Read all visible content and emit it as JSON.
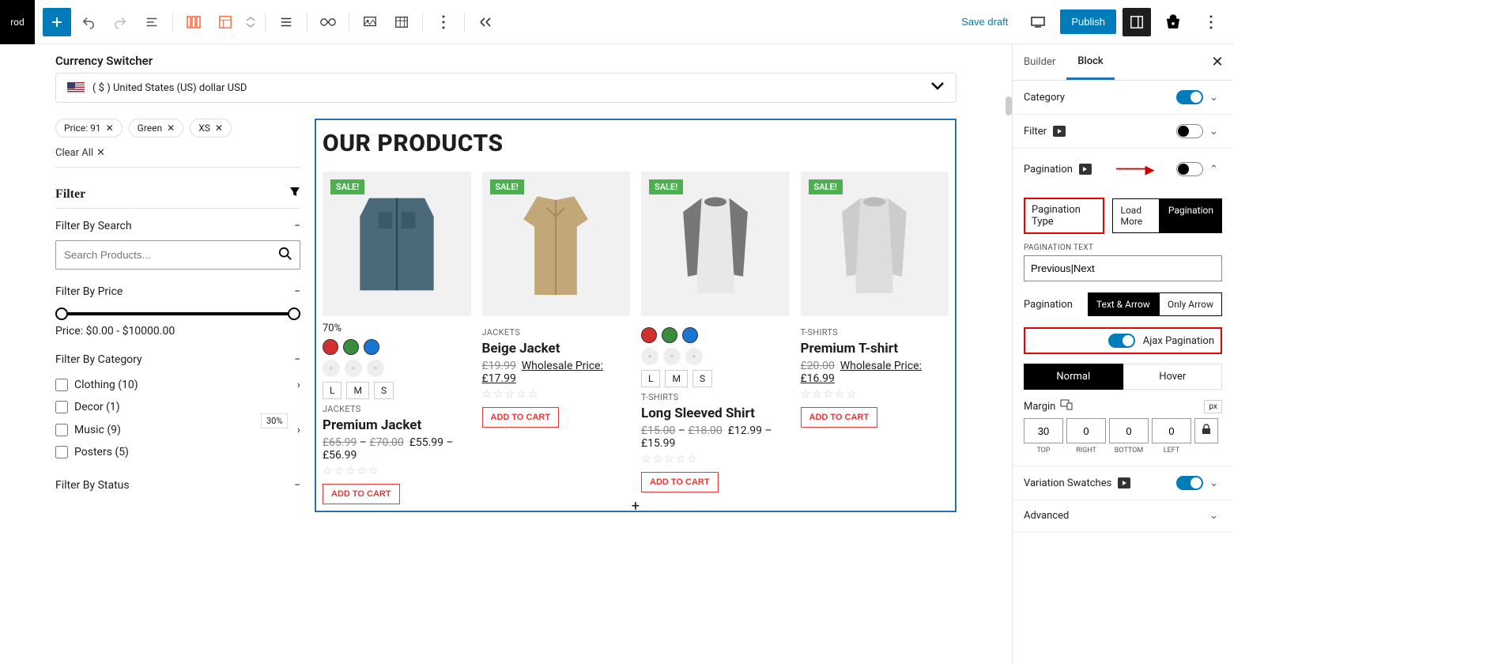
{
  "topbar": {
    "brand": "rod",
    "save_draft": "Save draft",
    "publish": "Publish"
  },
  "currency": {
    "title": "Currency Switcher",
    "value": "( $ ) United States (US) dollar USD"
  },
  "filters": {
    "chips": [
      {
        "label": "Price: 91"
      },
      {
        "label": "Green"
      },
      {
        "label": "XS"
      }
    ],
    "clear_all": "Clear All",
    "filter_head": "Filter",
    "search_head": "Filter By Search",
    "search_placeholder": "Search Products...",
    "price_head": "Filter By Price",
    "price_label": "Price: $0.00 - $10000.00",
    "category_head": "Filter By Category",
    "categories": [
      {
        "label": "Clothing (10)",
        "hasChildren": true
      },
      {
        "label": "Decor (1)",
        "hasChildren": false
      },
      {
        "label": "Music (9)",
        "hasChildren": true
      },
      {
        "label": "Posters (5)",
        "hasChildren": false
      }
    ],
    "discount_badge": "30%",
    "status_head": "Filter By Status"
  },
  "products": {
    "heading": "OUR PRODUCTS",
    "sale_label": "SALE!",
    "add_to_cart": "ADD TO CART",
    "items": [
      {
        "stock_pct": "70%",
        "category": "JACKETS",
        "title": "Premium Jacket",
        "price_html": "£65.99 – £70.00  £55.99 – £56.99",
        "old1": "£65.99",
        "old2": "£70.00",
        "new1": "£55.99",
        "new2": "£56.99",
        "img_kind": "denim"
      },
      {
        "category": "JACKETS",
        "title": "Beige Jacket",
        "old": "£19.99",
        "wholesale": "Wholesale Price:£17.99",
        "img_kind": "beige"
      },
      {
        "category": "T-SHIRTS",
        "title": "Long Sleeved Shirt",
        "old1": "£15.00",
        "old2": "£18.00",
        "new1": "£12.99",
        "new2": "£15.99",
        "img_kind": "grey"
      },
      {
        "category": "T-SHIRTS",
        "title": "Premium T-shirt",
        "old": "£20.00",
        "wholesale": "Wholesale Price:£16.99",
        "img_kind": "lightgrey"
      }
    ]
  },
  "settings": {
    "tabs": {
      "builder": "Builder",
      "block": "Block"
    },
    "category": "Category",
    "filter": "Filter",
    "pagination": "Pagination",
    "pagination_type": "Pagination Type",
    "load_more": "Load More",
    "pagination_btn": "Pagination",
    "pagination_text_label": "PAGINATION TEXT",
    "pagination_text_value": "Previous|Next",
    "pagination_display": "Pagination",
    "text_arrow": "Text & Arrow",
    "only_arrow": "Only Arrow",
    "ajax_pagination": "Ajax Pagination",
    "normal": "Normal",
    "hover": "Hover",
    "margin": "Margin",
    "unit": "px",
    "margin_vals": {
      "top": "30",
      "right": "0",
      "bottom": "0",
      "left": "0"
    },
    "margin_labels": {
      "top": "TOP",
      "right": "RIGHT",
      "bottom": "BOTTOM",
      "left": "LEFT"
    },
    "variation_swatches": "Variation Swatches",
    "advanced": "Advanced"
  }
}
